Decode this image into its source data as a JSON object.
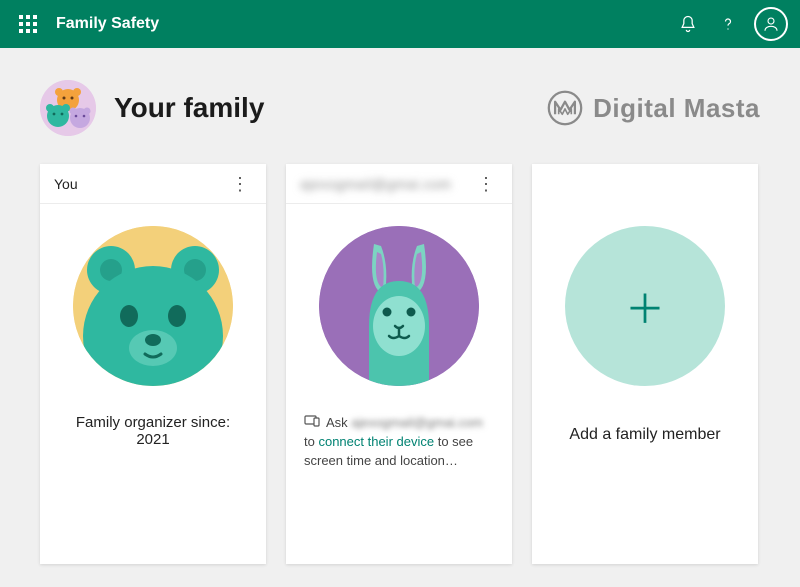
{
  "header": {
    "title": "Family Safety"
  },
  "page": {
    "title": "Your family",
    "brand": "Digital Masta"
  },
  "cards": {
    "you": {
      "title": "You",
      "caption": "Family organizer since: 2021"
    },
    "member": {
      "title": "ajexogmail@gmai.com",
      "hint_prefix": "Ask ",
      "hint_blurred": "ajexogmail@gmai.com",
      "hint_mid": " to ",
      "hint_link": "connect their device",
      "hint_suffix": " to see screen time and location…"
    },
    "add": {
      "label": "Add a family member"
    }
  }
}
